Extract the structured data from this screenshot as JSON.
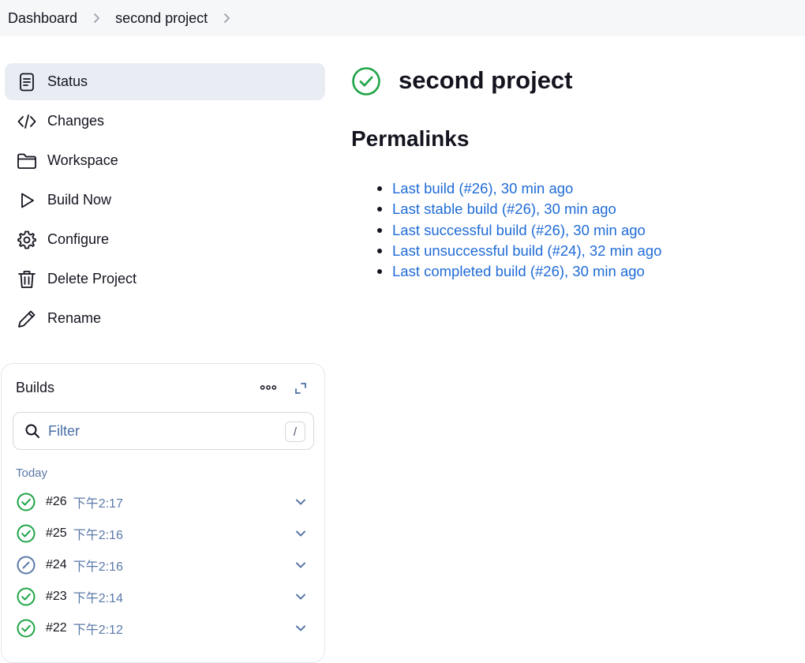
{
  "breadcrumb": {
    "items": [
      "Dashboard",
      "second project"
    ]
  },
  "sidebar": {
    "items": [
      {
        "label": "Status",
        "icon": "document-icon",
        "active": true
      },
      {
        "label": "Changes",
        "icon": "code-icon"
      },
      {
        "label": "Workspace",
        "icon": "folder-icon"
      },
      {
        "label": "Build Now",
        "icon": "play-icon"
      },
      {
        "label": "Configure",
        "icon": "gear-icon"
      },
      {
        "label": "Delete Project",
        "icon": "trash-icon"
      },
      {
        "label": "Rename",
        "icon": "pencil-icon"
      }
    ]
  },
  "builds": {
    "title": "Builds",
    "filter_placeholder": "Filter",
    "filter_shortcut": "/",
    "group_label": "Today",
    "items": [
      {
        "number": "#26",
        "time": "下午2:17",
        "status": "success"
      },
      {
        "number": "#25",
        "time": "下午2:16",
        "status": "success"
      },
      {
        "number": "#24",
        "time": "下午2:16",
        "status": "aborted"
      },
      {
        "number": "#23",
        "time": "下午2:14",
        "status": "success"
      },
      {
        "number": "#22",
        "time": "下午2:12",
        "status": "success"
      }
    ]
  },
  "main": {
    "title": "second project",
    "status": "success",
    "section_title": "Permalinks",
    "permalinks": [
      "Last build (#26), 30 min ago",
      "Last stable build (#26), 30 min ago",
      "Last successful build (#26), 30 min ago",
      "Last unsuccessful build (#24), 32 min ago",
      "Last completed build (#26), 30 min ago"
    ]
  },
  "colors": {
    "success": "#1ea446",
    "aborted": "#5a78a8",
    "link": "#1f6bd6",
    "active_nav_bg": "#e9edf3"
  }
}
